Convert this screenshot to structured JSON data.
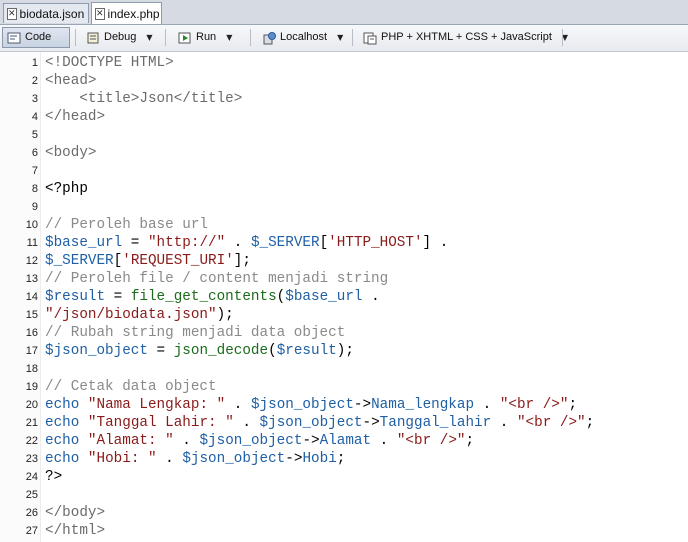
{
  "tabs": [
    {
      "label": "biodata.json",
      "icon": "json-file-icon",
      "active": false
    },
    {
      "label": "index.php",
      "icon": "php-file-icon",
      "active": true
    }
  ],
  "toolbar": {
    "code_label": "Code",
    "debug_label": "Debug",
    "run_label": "Run",
    "localhost_label": "Localhost",
    "language_label": "PHP + XHTML + CSS + JavaScript"
  },
  "editor": {
    "lines": [
      {
        "n": "1",
        "tokens": [
          {
            "c": "html",
            "t": "<!DOCTYPE HTML>"
          }
        ]
      },
      {
        "n": "2",
        "tokens": [
          {
            "c": "html",
            "t": "<head>"
          }
        ]
      },
      {
        "n": "3",
        "tokens": [
          {
            "c": "html",
            "t": "    <title>Json</title>"
          }
        ]
      },
      {
        "n": "4",
        "tokens": [
          {
            "c": "html",
            "t": "</head>"
          }
        ]
      },
      {
        "n": "5",
        "tokens": []
      },
      {
        "n": "6",
        "tokens": [
          {
            "c": "html",
            "t": "<body>"
          }
        ]
      },
      {
        "n": "7",
        "tokens": []
      },
      {
        "n": "8",
        "tokens": [
          {
            "c": "php",
            "t": "<?php"
          }
        ]
      },
      {
        "n": "9",
        "tokens": []
      },
      {
        "n": "10",
        "tokens": [
          {
            "c": "cm",
            "t": "// Peroleh base url"
          }
        ]
      },
      {
        "n": "11",
        "tokens": [
          {
            "c": "var",
            "t": "$base_url"
          },
          {
            "c": "op",
            "t": " = "
          },
          {
            "c": "str",
            "t": "\"http://\""
          },
          {
            "c": "op",
            "t": " . "
          },
          {
            "c": "var",
            "t": "$_SERVER"
          },
          {
            "c": "op",
            "t": "["
          },
          {
            "c": "str",
            "t": "'HTTP_HOST'"
          },
          {
            "c": "op",
            "t": "] ."
          }
        ]
      },
      {
        "n": "12",
        "tokens": [
          {
            "c": "var",
            "t": "$_SERVER"
          },
          {
            "c": "op",
            "t": "["
          },
          {
            "c": "str",
            "t": "'REQUEST_URI'"
          },
          {
            "c": "op",
            "t": "];"
          }
        ]
      },
      {
        "n": "13",
        "tokens": [
          {
            "c": "cm",
            "t": "// Peroleh file / content menjadi string"
          }
        ]
      },
      {
        "n": "14",
        "tokens": [
          {
            "c": "var",
            "t": "$result"
          },
          {
            "c": "op",
            "t": " = "
          },
          {
            "c": "fn",
            "t": "file_get_contents"
          },
          {
            "c": "op",
            "t": "("
          },
          {
            "c": "var",
            "t": "$base_url"
          },
          {
            "c": "op",
            "t": " ."
          }
        ]
      },
      {
        "n": "15",
        "tokens": [
          {
            "c": "str",
            "t": "\"/json/biodata.json\""
          },
          {
            "c": "op",
            "t": ");"
          }
        ]
      },
      {
        "n": "16",
        "tokens": [
          {
            "c": "cm",
            "t": "// Rubah string menjadi data object"
          }
        ]
      },
      {
        "n": "17",
        "tokens": [
          {
            "c": "var",
            "t": "$json_object"
          },
          {
            "c": "op",
            "t": " = "
          },
          {
            "c": "fn",
            "t": "json_decode"
          },
          {
            "c": "op",
            "t": "("
          },
          {
            "c": "var",
            "t": "$result"
          },
          {
            "c": "op",
            "t": ");"
          }
        ]
      },
      {
        "n": "18",
        "tokens": []
      },
      {
        "n": "19",
        "tokens": [
          {
            "c": "cm",
            "t": "// Cetak data object"
          }
        ]
      },
      {
        "n": "20",
        "tokens": [
          {
            "c": "kw",
            "t": "echo"
          },
          {
            "c": "op",
            "t": " "
          },
          {
            "c": "str",
            "t": "\"Nama Lengkap: \""
          },
          {
            "c": "op",
            "t": " . "
          },
          {
            "c": "var",
            "t": "$json_object"
          },
          {
            "c": "op",
            "t": "->"
          },
          {
            "c": "var",
            "t": "Nama_lengkap"
          },
          {
            "c": "op",
            "t": " . "
          },
          {
            "c": "str",
            "t": "\"<br />\""
          },
          {
            "c": "op",
            "t": ";"
          }
        ]
      },
      {
        "n": "21",
        "tokens": [
          {
            "c": "kw",
            "t": "echo"
          },
          {
            "c": "op",
            "t": " "
          },
          {
            "c": "str",
            "t": "\"Tanggal Lahir: \""
          },
          {
            "c": "op",
            "t": " . "
          },
          {
            "c": "var",
            "t": "$json_object"
          },
          {
            "c": "op",
            "t": "->"
          },
          {
            "c": "var",
            "t": "Tanggal_lahir"
          },
          {
            "c": "op",
            "t": " . "
          },
          {
            "c": "str",
            "t": "\"<br />\""
          },
          {
            "c": "op",
            "t": ";"
          }
        ]
      },
      {
        "n": "22",
        "tokens": [
          {
            "c": "kw",
            "t": "echo"
          },
          {
            "c": "op",
            "t": " "
          },
          {
            "c": "str",
            "t": "\"Alamat: \""
          },
          {
            "c": "op",
            "t": " . "
          },
          {
            "c": "var",
            "t": "$json_object"
          },
          {
            "c": "op",
            "t": "->"
          },
          {
            "c": "var",
            "t": "Alamat"
          },
          {
            "c": "op",
            "t": " . "
          },
          {
            "c": "str",
            "t": "\"<br />\""
          },
          {
            "c": "op",
            "t": ";"
          }
        ]
      },
      {
        "n": "23",
        "tokens": [
          {
            "c": "kw",
            "t": "echo"
          },
          {
            "c": "op",
            "t": " "
          },
          {
            "c": "str",
            "t": "\"Hobi: \""
          },
          {
            "c": "op",
            "t": " . "
          },
          {
            "c": "var",
            "t": "$json_object"
          },
          {
            "c": "op",
            "t": "->"
          },
          {
            "c": "var",
            "t": "Hobi"
          },
          {
            "c": "op",
            "t": ";"
          }
        ]
      },
      {
        "n": "24",
        "tokens": [
          {
            "c": "php",
            "t": "?>"
          }
        ]
      },
      {
        "n": "25",
        "tokens": []
      },
      {
        "n": "26",
        "tokens": [
          {
            "c": "html",
            "t": "</body>"
          }
        ]
      },
      {
        "n": "27",
        "tokens": [
          {
            "c": "html",
            "t": "</html>"
          }
        ]
      }
    ]
  }
}
